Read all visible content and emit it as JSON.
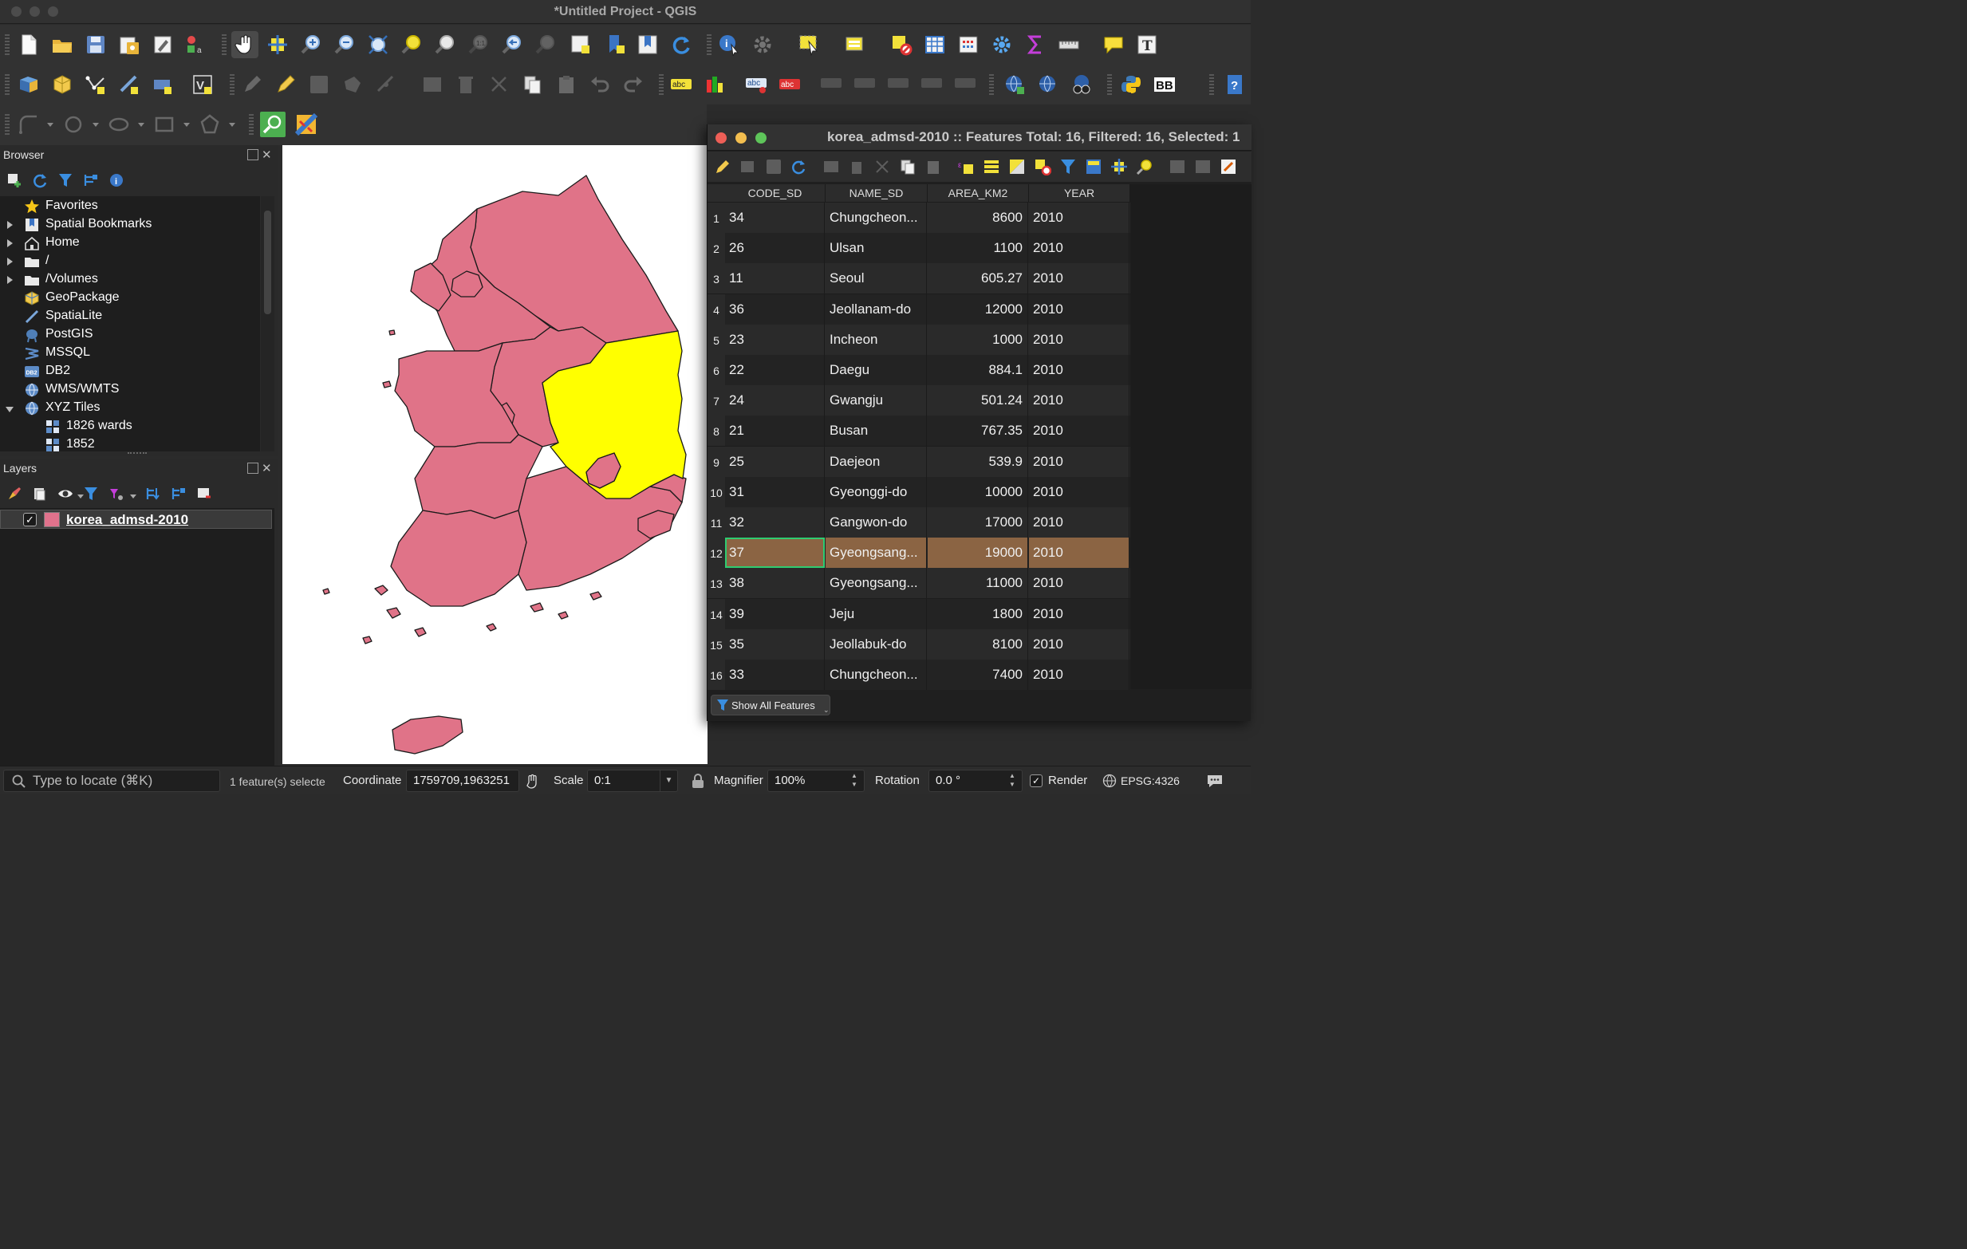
{
  "app": {
    "title": "*Untitled Project - QGIS"
  },
  "browser": {
    "title": "Browser",
    "items": [
      {
        "label": "Favorites",
        "icon": "star-icon"
      },
      {
        "label": "Spatial Bookmarks",
        "icon": "bookmark-icon"
      },
      {
        "label": "Home",
        "icon": "home-icon"
      },
      {
        "label": "/",
        "icon": "folder-icon"
      },
      {
        "label": "/Volumes",
        "icon": "folder-icon"
      },
      {
        "label": "GeoPackage",
        "icon": "geopackage-icon"
      },
      {
        "label": "SpatiaLite",
        "icon": "spatialite-icon"
      },
      {
        "label": "PostGIS",
        "icon": "postgis-icon"
      },
      {
        "label": "MSSQL",
        "icon": "mssql-icon"
      },
      {
        "label": "DB2",
        "icon": "db2-icon"
      },
      {
        "label": "WMS/WMTS",
        "icon": "globe-icon"
      },
      {
        "label": "XYZ Tiles",
        "icon": "globe-icon"
      },
      {
        "label": "1826 wards",
        "icon": "tiles-icon"
      },
      {
        "label": "1852",
        "icon": "tiles-icon"
      }
    ],
    "db2_badge": "DB2"
  },
  "layers": {
    "title": "Layers",
    "items": [
      {
        "label": "korea_admsd-2010",
        "checked": true,
        "swatch": "#e0728c"
      }
    ]
  },
  "map": {
    "fill": "#e07388",
    "selected_fill": "#ffff00",
    "background": "#ffffff"
  },
  "attribute_table": {
    "title": "korea_admsd-2010 :: Features Total: 16, Filtered: 16, Selected: 1",
    "columns": [
      "CODE_SD",
      "NAME_SD",
      "AREA_KM2",
      "YEAR"
    ],
    "rows": [
      [
        "34",
        "Chungcheon...",
        "8600",
        "2010"
      ],
      [
        "26",
        "Ulsan",
        "1100",
        "2010"
      ],
      [
        "11",
        "Seoul",
        "605.27",
        "2010"
      ],
      [
        "36",
        "Jeollanam-do",
        "12000",
        "2010"
      ],
      [
        "23",
        "Incheon",
        "1000",
        "2010"
      ],
      [
        "22",
        "Daegu",
        "884.1",
        "2010"
      ],
      [
        "24",
        "Gwangju",
        "501.24",
        "2010"
      ],
      [
        "21",
        "Busan",
        "767.35",
        "2010"
      ],
      [
        "25",
        "Daejeon",
        "539.9",
        "2010"
      ],
      [
        "31",
        "Gyeonggi-do",
        "10000",
        "2010"
      ],
      [
        "32",
        "Gangwon-do",
        "17000",
        "2010"
      ],
      [
        "37",
        "Gyeongsang...",
        "19000",
        "2010"
      ],
      [
        "38",
        "Gyeongsang...",
        "11000",
        "2010"
      ],
      [
        "39",
        "Jeju",
        "1800",
        "2010"
      ],
      [
        "35",
        "Jeollabuk-do",
        "8100",
        "2010"
      ],
      [
        "33",
        "Chungcheon...",
        "7400",
        "2010"
      ]
    ],
    "selected_row": 12,
    "selected_color": "#8b6443",
    "focus_color": "#2ecc71",
    "filter_button": "Show All Features"
  },
  "statusbar": {
    "locate_placeholder": "Type to locate (⌘K)",
    "message": "1 feature(s) selecte",
    "coordinate_label": "Coordinate",
    "coordinate_value": "1759709,1963251",
    "scale_label": "Scale",
    "scale_value": "0:1",
    "magnifier_label": "Magnifier",
    "magnifier_value": "100%",
    "rotation_label": "Rotation",
    "rotation_value": "0.0 °",
    "render_label": "Render",
    "render_checked": true,
    "crs": "EPSG:4326"
  },
  "toolbar_text": {
    "abc": "abc",
    "bb": "BB",
    "help": "?"
  }
}
